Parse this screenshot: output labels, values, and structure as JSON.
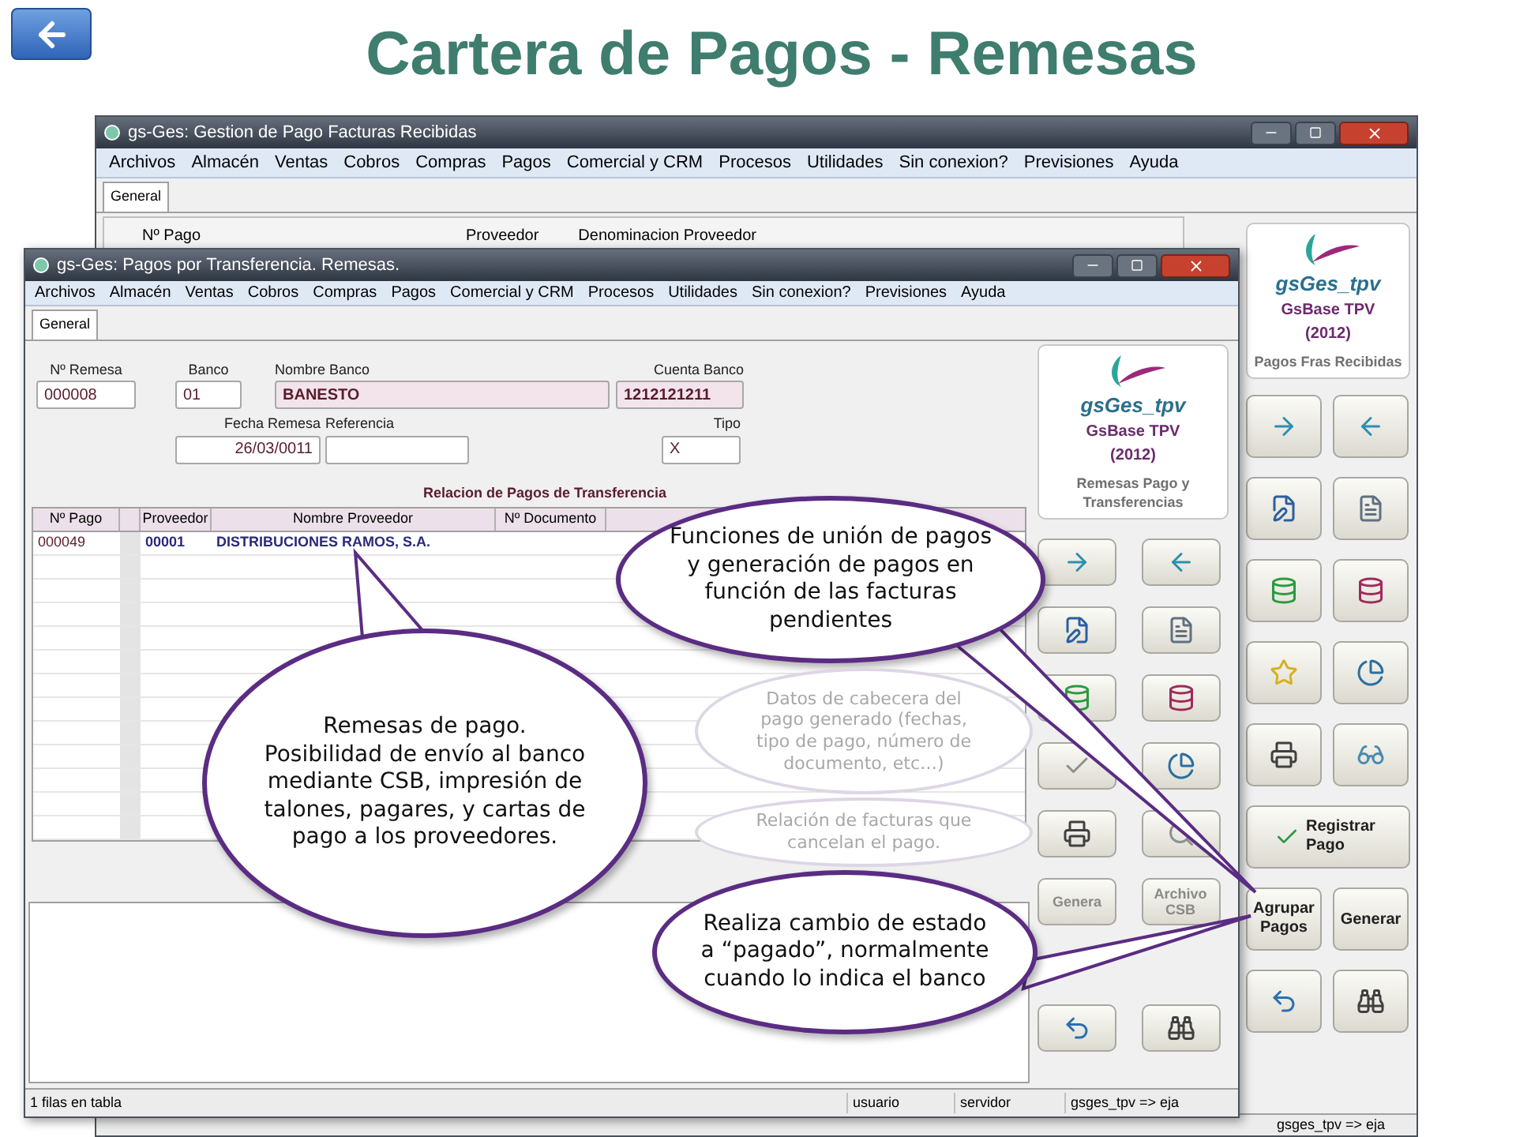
{
  "slide": {
    "title": "Cartera de Pagos - Remesas"
  },
  "back_window": {
    "title": "gs-Ges: Gestion de Pago Facturas Recibidas",
    "menu": [
      "Archivos",
      "Almacén",
      "Ventas",
      "Cobros",
      "Compras",
      "Pagos",
      "Comercial y CRM",
      "Procesos",
      "Utilidades",
      "Sin conexion?",
      "Previsiones",
      "Ayuda"
    ],
    "tabs": [
      {
        "label": "General",
        "selected": true
      }
    ],
    "header_labels": [
      "Nº Pago",
      "Proveedor",
      "Denominacion Proveedor"
    ],
    "logo": {
      "brand": "gsGes_tpv",
      "product": "GsBase TPV",
      "year": "(2012)",
      "caption": "Pagos Fras Recibidas"
    },
    "buttons": [
      "Registrar Pago",
      "Agrupar Pagos",
      "Generar"
    ],
    "status_bar": [
      "gsges_tpv => eja"
    ]
  },
  "front_window": {
    "title": "gs-Ges: Pagos por Transferencia. Remesas.",
    "menu": [
      "Archivos",
      "Almacén",
      "Ventas",
      "Cobros",
      "Compras",
      "Pagos",
      "Comercial y CRM",
      "Procesos",
      "Utilidades",
      "Sin conexion?",
      "Previsiones",
      "Ayuda"
    ],
    "tabs": [
      {
        "label": "General",
        "selected": true
      }
    ],
    "form": {
      "fields": [
        {
          "label": "Nº Remesa",
          "value": "000008",
          "readonly": false
        },
        {
          "label": "Banco",
          "value": "01",
          "readonly": false
        },
        {
          "label": "Nombre Banco",
          "value": "BANESTO",
          "readonly": true
        },
        {
          "label": "Cuenta Banco",
          "value": "1212121211",
          "readonly": true
        },
        {
          "label": "Fecha Remesa",
          "value": "26/03/0011",
          "readonly": false
        },
        {
          "label": "Referencia",
          "readonly": false
        },
        {
          "label": "Tipo",
          "value": "X",
          "readonly": false
        }
      ]
    },
    "table": {
      "title": "Relacion de Pagos de Transferencia",
      "columns": [
        "Nº Pago",
        "Proveedor",
        "Nombre Proveedor",
        "Nº Documento"
      ],
      "rows": [
        [
          "000049",
          "00001",
          "DISTRIBUCIONES RAMOS, S.A."
        ]
      ]
    },
    "logo": {
      "brand": "gsGes_tpv",
      "product": "GsBase TPV",
      "year": "(2012)",
      "caption": "Remesas Pago y Transferencias"
    },
    "buttons": [
      {
        "label": "Genera",
        "disabled": true
      },
      {
        "label": "Archivo CSB",
        "disabled": true
      }
    ],
    "status_bar": [
      "1 filas en tabla",
      "usuario",
      "servidor",
      "gsges_tpv => eja"
    ]
  },
  "callouts": [
    {
      "text": "Funciones de unión de pagos y generación de pagos en función de las facturas pendientes",
      "faded": false
    },
    {
      "text": "Datos de cabecera del pago generado (fechas, tipo de pago, número de documento, etc…)",
      "faded": true
    },
    {
      "text": "Remesas de pago.\nPosibilidad de envío al banco mediante CSB, impresión de talones, pagares, y cartas de pago a los proveedores.",
      "faded": false
    },
    {
      "text": "Relación de facturas que cancelan el pago.",
      "faded": true
    },
    {
      "text": "Realiza cambio de estado a “pagado”, normalmente cuando lo indica el banco",
      "faded": false
    }
  ]
}
